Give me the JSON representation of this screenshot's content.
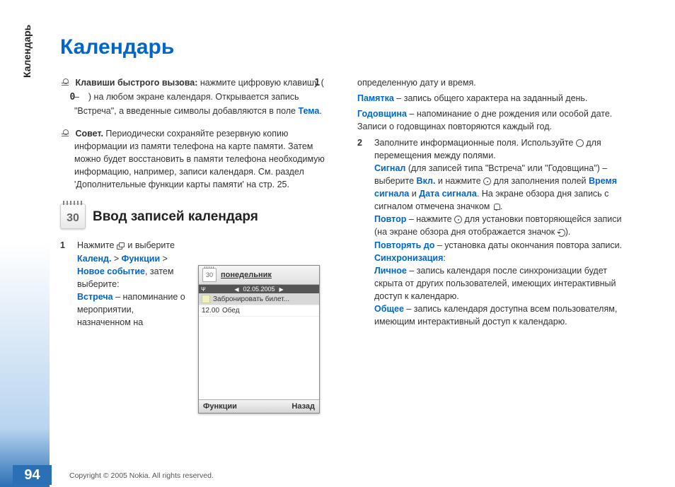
{
  "page_number": "94",
  "side_label": "Календарь",
  "main_title": "Календарь",
  "tip1": {
    "label": "Клавиши быстрого вызова:",
    "text_a": " нажмите цифровую клавишу ( ",
    "key1": "1",
    "dash": " – ",
    "key0": "0",
    "text_b": " ) на любом экране календаря. Открывается запись \"Встреча\", а введенные символы добавляются в поле ",
    "link": "Тема",
    "text_c": "."
  },
  "tip2": {
    "label": "Совет.",
    "text": " Периодически сохраняйте резервную копию информации из памяти телефона на карте памяти. Затем можно будет восстановить в памяти телефона необходимую информацию, например, записи календаря. См. раздел 'Дополнительные функции карты памяти' на стр. 25."
  },
  "section_icon_day": "30",
  "section_title": "Ввод записей календаря",
  "step1": {
    "num": "1",
    "text_a": " Нажмите ",
    "text_b": " и выберите ",
    "link1": "Календ.",
    "gt1": " > ",
    "link2": "Функции",
    "gt2": " > ",
    "link3": "Новое событие",
    "text_c": ", затем выберите:",
    "meeting_label": "Встреча",
    "meeting_text": " – напоминание о мероприятии, назначенном на"
  },
  "col2": {
    "line1": "определенную дату и время.",
    "memo_label": "Памятка",
    "memo_text": " –  запись общего характера на заданный день.",
    "anniv_label": "Годовщина",
    "anniv_text": " –  напоминание о дне рождения или особой дате. Записи о годовщинах повторяются каждый год.",
    "step2_num": "2",
    "step2_a": "Заполните информационные поля. Используйте ",
    "step2_b": " для перемещения между полями.",
    "signal_label": "Сигнал",
    "signal_a": " (для записей типа \"Встреча\" или \"Годовщина\") –  выберите ",
    "signal_on": "Вкл.",
    "signal_b": " и нажмите ",
    "signal_c": " для заполнения полей ",
    "signal_time": "Время сигнала",
    "signal_and": " и ",
    "signal_date": "Дата сигнала",
    "signal_d": ". На экране обзора дня запись с сигналом отмечена значком ",
    "signal_e": ".",
    "repeat_label": "Повтор",
    "repeat_a": " –  нажмите ",
    "repeat_b": " для установки повторяющейся записи (на экране обзора дня отображается значок ",
    "repeat_c": ").",
    "repeat_until_label": "Повторять до",
    "repeat_until_text": " –  установка даты окончания повтора записи.",
    "sync_label": "Синхронизация",
    "sync_colon": ":",
    "private_label": "Личное",
    "private_text": " –  запись календаря после синхронизации будет скрыта от других пользователей, имеющих интерактивный доступ к календарю.",
    "public_label": "Общее",
    "public_text": " –  запись календаря доступна всем пользователям, имеющим интерактивный доступ к календарю."
  },
  "phone": {
    "icon_day": "30",
    "day": "понедельник",
    "date": "02.05.2005",
    "item1": "Забронировать билет...",
    "item2_time": "12.00",
    "item2_text": "Обед",
    "left": "Функции",
    "right": "Назад"
  },
  "copyright": "Copyright © 2005 Nokia. All rights reserved."
}
